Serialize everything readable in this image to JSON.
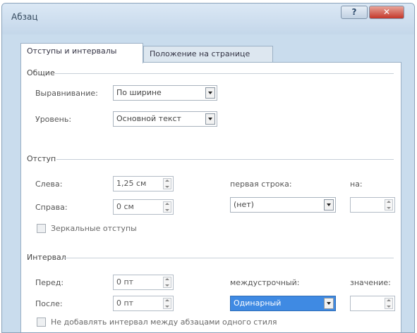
{
  "window": {
    "title": "Абзац",
    "help_glyph": "?",
    "close_glyph": "✕"
  },
  "tabs": [
    {
      "label": "Отступы и интервалы",
      "active": true
    },
    {
      "label": "Положение на странице",
      "active": false
    }
  ],
  "general": {
    "title": "Общие",
    "alignment_label": "Выравнивание:",
    "alignment_value": "По ширине",
    "level_label": "Уровень:",
    "level_value": "Основной текст"
  },
  "indent": {
    "title": "Отступ",
    "left_label": "Слева:",
    "left_value": "1,25 см",
    "right_label": "Справа:",
    "right_value": "0 см",
    "first_line_label": "первая строка:",
    "first_line_value": "(нет)",
    "by_label": "на:",
    "by_value": "",
    "mirror_label": "Зеркальные отступы"
  },
  "spacing": {
    "title": "Интервал",
    "before_label": "Перед:",
    "before_value": "0 пт",
    "after_label": "После:",
    "after_value": "0 пт",
    "line_spacing_label": "междустрочный:",
    "line_spacing_value": "Одинарный",
    "value_label": "значение:",
    "value_value": "",
    "no_space_label": "Не добавлять интервал между абзацами одного стиля"
  }
}
